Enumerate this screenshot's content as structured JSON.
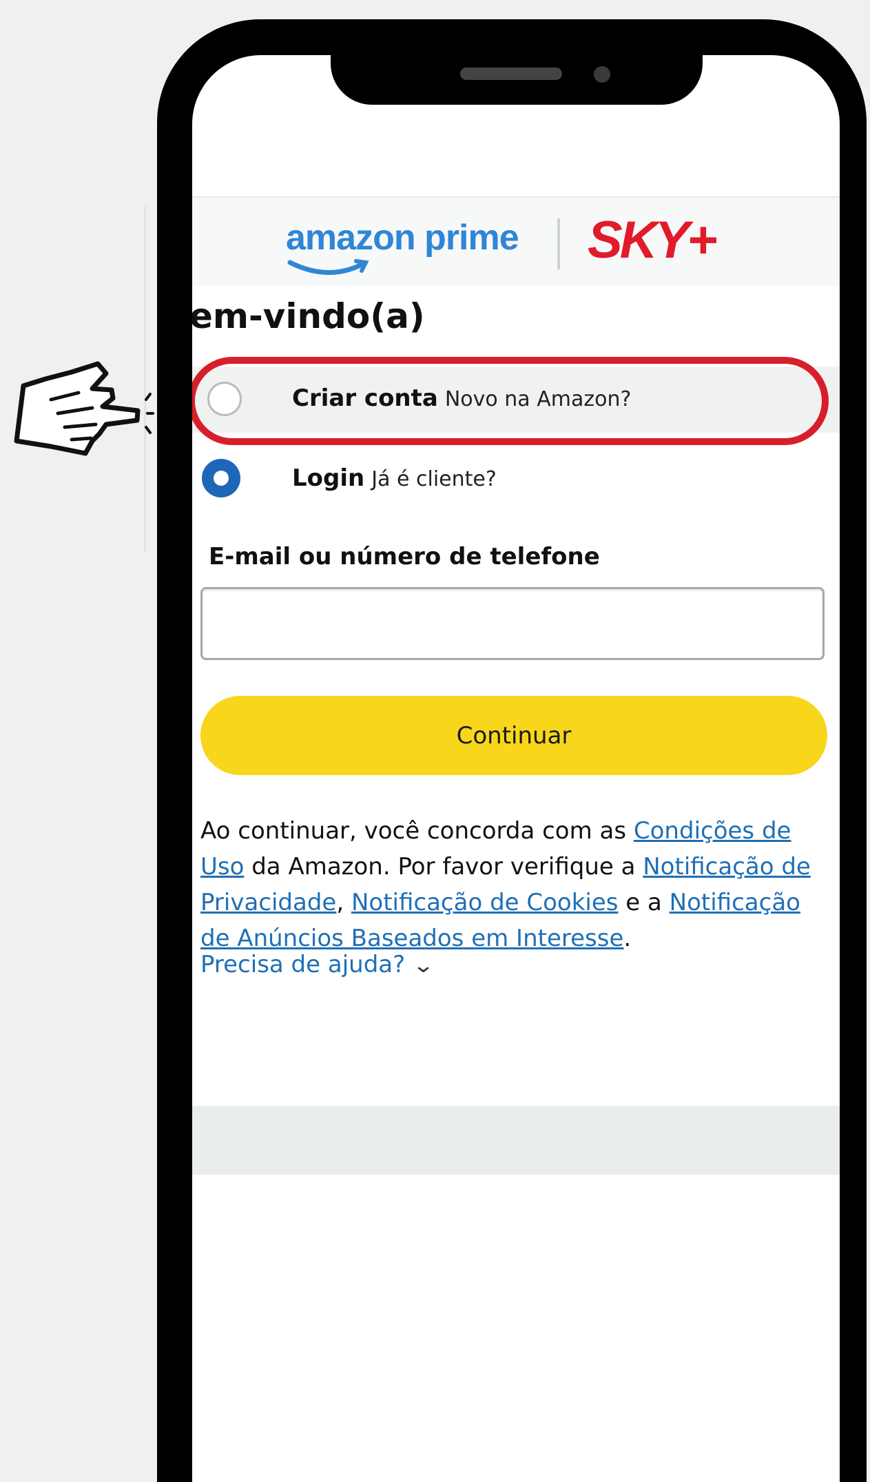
{
  "brand": {
    "primary": "amazon prime",
    "partner": "SKY+",
    "primary_color": "#2f86d6",
    "partner_color": "#e11b2a"
  },
  "page": {
    "welcome": "em-vindo(a)"
  },
  "options": {
    "create": {
      "label": "Criar conta",
      "sub": "Novo na Amazon?",
      "selected": false
    },
    "login": {
      "label": "Login",
      "sub": "Já é cliente?",
      "selected": true
    }
  },
  "form": {
    "email_label": "E-mail ou número de telefone",
    "email_value": "",
    "continue_label": "Continuar",
    "button_color": "#f8d61c"
  },
  "legal": {
    "t1": "Ao continuar, você concorda com as ",
    "link_terms": "Condições de Uso",
    "t2": " da Amazon. Por favor verifique a ",
    "link_privacy": "Notificação de Privacidade",
    "t3": ", ",
    "link_cookies": "Notificação de Cookies",
    "t4": " e a ",
    "link_ads": "Notificação de Anúncios Baseados em Interesse",
    "t5": "."
  },
  "help": {
    "label": "Precisa de ajuda?"
  },
  "annotation": {
    "highlight_color": "#d71f2b",
    "pointer_icon": "pointing-hand-icon"
  }
}
